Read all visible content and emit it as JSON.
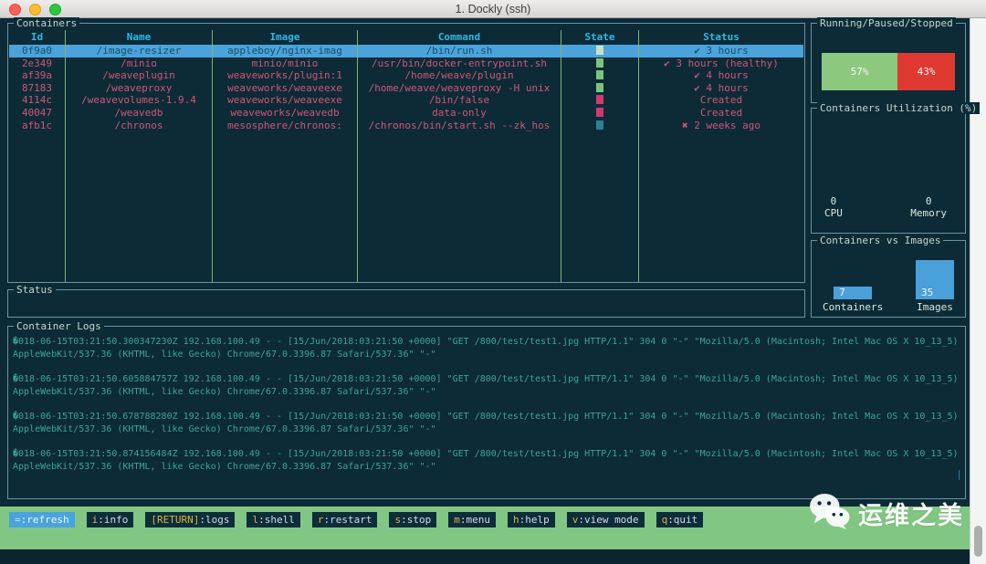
{
  "window": {
    "title": "1. Dockly (ssh)"
  },
  "containers_panel": {
    "title": "Containers",
    "columns": [
      "Id",
      "Name",
      "Image",
      "Command",
      "State",
      "Status"
    ],
    "rows": [
      {
        "id": "0f9a0",
        "name": "/image-resizer",
        "image": "appleboy/nginx-imag",
        "command": "/bin/run.sh",
        "state": "running",
        "status": "✔ 3 hours",
        "selected": true
      },
      {
        "id": "2e349",
        "name": "/minio",
        "image": "minio/minio",
        "command": "/usr/bin/docker-entrypoint.sh",
        "state": "running",
        "status": "✔ 3 hours (healthy)",
        "selected": false
      },
      {
        "id": "af39a",
        "name": "/weaveplugin",
        "image": "weaveworks/plugin:1",
        "command": "/home/weave/plugin",
        "state": "running",
        "status": "✔ 4 hours",
        "selected": false
      },
      {
        "id": "87183",
        "name": "/weaveproxy",
        "image": "weaveworks/weaveexe",
        "command": "/home/weave/weaveproxy -H unix",
        "state": "running",
        "status": "✔ 4 hours",
        "selected": false
      },
      {
        "id": "4114c",
        "name": "/weavevolumes-1.9.4",
        "image": "weaveworks/weaveexe",
        "command": "/bin/false",
        "state": "created",
        "status": "Created",
        "selected": false
      },
      {
        "id": "40047",
        "name": "/weavedb",
        "image": "weaveworks/weavedb",
        "command": "data-only",
        "state": "created",
        "status": "Created",
        "selected": false
      },
      {
        "id": "afb1c",
        "name": "/chronos",
        "image": "mesosphere/chronos:",
        "command": "/chronos/bin/start.sh --zk_hos",
        "state": "exited",
        "status": "✖ 2 weeks ago",
        "selected": false
      }
    ]
  },
  "sidebar": {
    "gauge_panel": {
      "title": "Running/Paused/Stopped",
      "segments": [
        {
          "name": "running",
          "label": "57%",
          "value": 57,
          "color": "#8cc97e"
        },
        {
          "name": "stopped",
          "label": "43%",
          "value": 43,
          "color": "#de3a32"
        }
      ]
    },
    "utilization_panel": {
      "title": "Containers Utilization (%)",
      "metrics": [
        {
          "value": "0",
          "label": "CPU"
        },
        {
          "value": "0",
          "label": "Memory"
        }
      ]
    },
    "vs_panel": {
      "title": "Containers vs Images",
      "bar_color": "#4aa0d8",
      "bars": [
        {
          "label": "Containers",
          "value": 7
        },
        {
          "label": "Images",
          "value": 35
        }
      ]
    }
  },
  "status_panel": {
    "title": "Status",
    "content": ""
  },
  "logs_panel": {
    "title": "Container Logs",
    "cursor": "|",
    "entries": [
      {
        "request_line": "�018-06-15T03:21:50.300347230Z 192.168.100.49 - - [15/Jun/2018:03:21:50 +0000] \"GET /800/test/test1.jpg HTTP/1.1\" 304 0 \"-\" \"Mozilla/5.0 (Macintosh; Intel Mac OS X 10_13_5)",
        "agent_line": "AppleWebKit/537.36 (KHTML, like Gecko) Chrome/67.0.3396.87 Safari/537.36\" \"-\""
      },
      {
        "request_line": "�018-06-15T03:21:50.605884757Z 192.168.100.49 - - [15/Jun/2018:03:21:50 +0000] \"GET /800/test/test1.jpg HTTP/1.1\" 304 0 \"-\" \"Mozilla/5.0 (Macintosh; Intel Mac OS X 10_13_5)",
        "agent_line": "AppleWebKit/537.36 (KHTML, like Gecko) Chrome/67.0.3396.87 Safari/537.36\" \"-\""
      },
      {
        "request_line": "�018-06-15T03:21:50.678788280Z 192.168.100.49 - - [15/Jun/2018:03:21:50 +0000] \"GET /800/test/test1.jpg HTTP/1.1\" 304 0 \"-\" \"Mozilla/5.0 (Macintosh; Intel Mac OS X 10_13_5)",
        "agent_line": "AppleWebKit/537.36 (KHTML, like Gecko) Chrome/67.0.3396.87 Safari/537.36\" \"-\""
      },
      {
        "request_line": "�018-06-15T03:21:50.874156484Z 192.168.100.49 - - [15/Jun/2018:03:21:50 +0000] \"GET /800/test/test1.jpg HTTP/1.1\" 304 0 \"-\" \"Mozilla/5.0 (Macintosh; Intel Mac OS X 10_13_5)",
        "agent_line": "AppleWebKit/537.36 (KHTML, like Gecko) Chrome/67.0.3396.87 Safari/537.36\" \"-\""
      }
    ]
  },
  "footer": {
    "items": [
      {
        "name": "refresh",
        "key": "=",
        "label": ":refresh",
        "selected": true
      },
      {
        "name": "info",
        "key": "i",
        "label": ":info",
        "selected": false
      },
      {
        "name": "logs",
        "key": "[RETURN]",
        "label": ":logs",
        "selected": false
      },
      {
        "name": "shell",
        "key": "l",
        "label": ":shell",
        "selected": false
      },
      {
        "name": "restart",
        "key": "r",
        "label": ":restart",
        "selected": false
      },
      {
        "name": "stop",
        "key": "s",
        "label": ":stop",
        "selected": false
      },
      {
        "name": "menu",
        "key": "m",
        "label": ":menu",
        "selected": false
      },
      {
        "name": "help",
        "key": "h",
        "label": ":help",
        "selected": false
      },
      {
        "name": "view-mode",
        "key": "v",
        "label": ":view mode",
        "selected": false
      },
      {
        "name": "quit",
        "key": "q",
        "label": ":quit",
        "selected": false
      }
    ]
  },
  "watermark": {
    "text": "运维之美"
  },
  "colors": {
    "state_running": "#7cc578",
    "state_created": "#d23a6d",
    "state_exited": "#2f7d9c",
    "state_selected": "#c9e0c4",
    "selected_row_bg": "#4ba3dc",
    "row_text": "#d15577",
    "header_text": "#32b8e0",
    "log_text": "#41a392",
    "footer_bg": "#81c783",
    "terminal_bg": "#0c2b37"
  }
}
